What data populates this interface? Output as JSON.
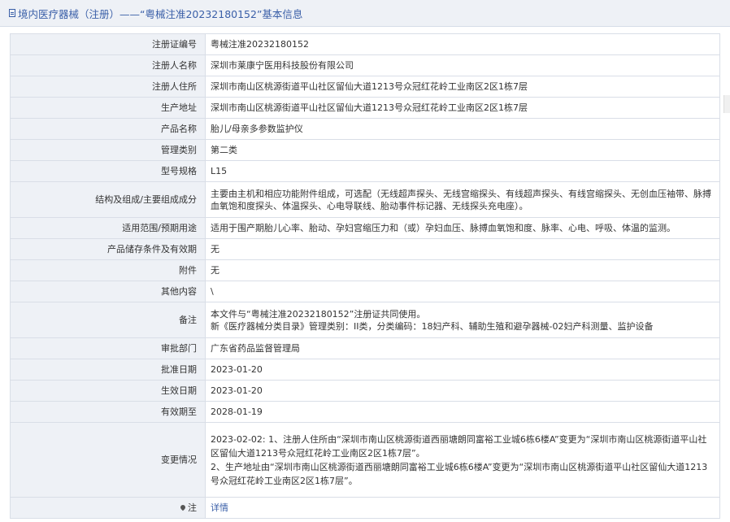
{
  "title": "境内医疗器械（注册）——“粤械注准20232180152”基本信息",
  "rows": [
    {
      "label": "注册证编号",
      "value": "粤械注准20232180152"
    },
    {
      "label": "注册人名称",
      "value": "深圳市莱康宁医用科技股份有限公司"
    },
    {
      "label": "注册人住所",
      "value": "深圳市南山区桃源街道平山社区留仙大道1213号众冠红花岭工业南区2区1栋7层"
    },
    {
      "label": "生产地址",
      "value": "深圳市南山区桃源街道平山社区留仙大道1213号众冠红花岭工业南区2区1栋7层"
    },
    {
      "label": "产品名称",
      "value": "胎儿/母亲多参数监护仪"
    },
    {
      "label": "管理类别",
      "value": "第二类"
    },
    {
      "label": "型号规格",
      "value": "L15"
    },
    {
      "label": "结构及组成/主要组成成分",
      "value": "主要由主机和相应功能附件组成，可选配（无线超声探头、无线宫缩探头、有线超声探头、有线宫缩探头、无创血压袖带、脉搏血氧饱和度探头、体温探头、心电导联线、胎动事件标记器、无线探头充电座）。"
    },
    {
      "label": "适用范围/预期用途",
      "value": "适用于围产期胎儿心率、胎动、孕妇宫缩压力和（或）孕妇血压、脉搏血氧饱和度、脉率、心电、呼吸、体温的监测。"
    },
    {
      "label": "产品储存条件及有效期",
      "value": "无"
    },
    {
      "label": "附件",
      "value": "无"
    },
    {
      "label": "其他内容",
      "value": "\\"
    },
    {
      "label": "备注",
      "value_lines": [
        "本文件与“粤械注准20232180152”注册证共同使用。",
        "新《医疗器械分类目录》管理类别：II类，分类编码：18妇产科、辅助生殖和避孕器械-02妇产科测量、监护设备"
      ]
    },
    {
      "label": "审批部门",
      "value": "广东省药品监督管理局"
    },
    {
      "label": "批准日期",
      "value": "2023-01-20"
    },
    {
      "label": "生效日期",
      "value": "2023-01-20"
    },
    {
      "label": "有效期至",
      "value": "2028-01-19"
    },
    {
      "label": "变更情况",
      "value": "2023-02-02: 1、注册人住所由“深圳市南山区桃源街道西丽塘朗同富裕工业城6栋6楼A”变更为“深圳市南山区桃源街道平山社区留仙大道1213号众冠红花岭工业南区2区1栋7层”。\n2、生产地址由“深圳市南山区桃源街道西丽塘朗同富裕工业城6栋6楼A”变更为“深圳市南山区桃源街道平山社区留仙大道1213号众冠红花岭工业南区2区1栋7层”。"
    },
    {
      "label": "注",
      "value": "详情"
    }
  ]
}
